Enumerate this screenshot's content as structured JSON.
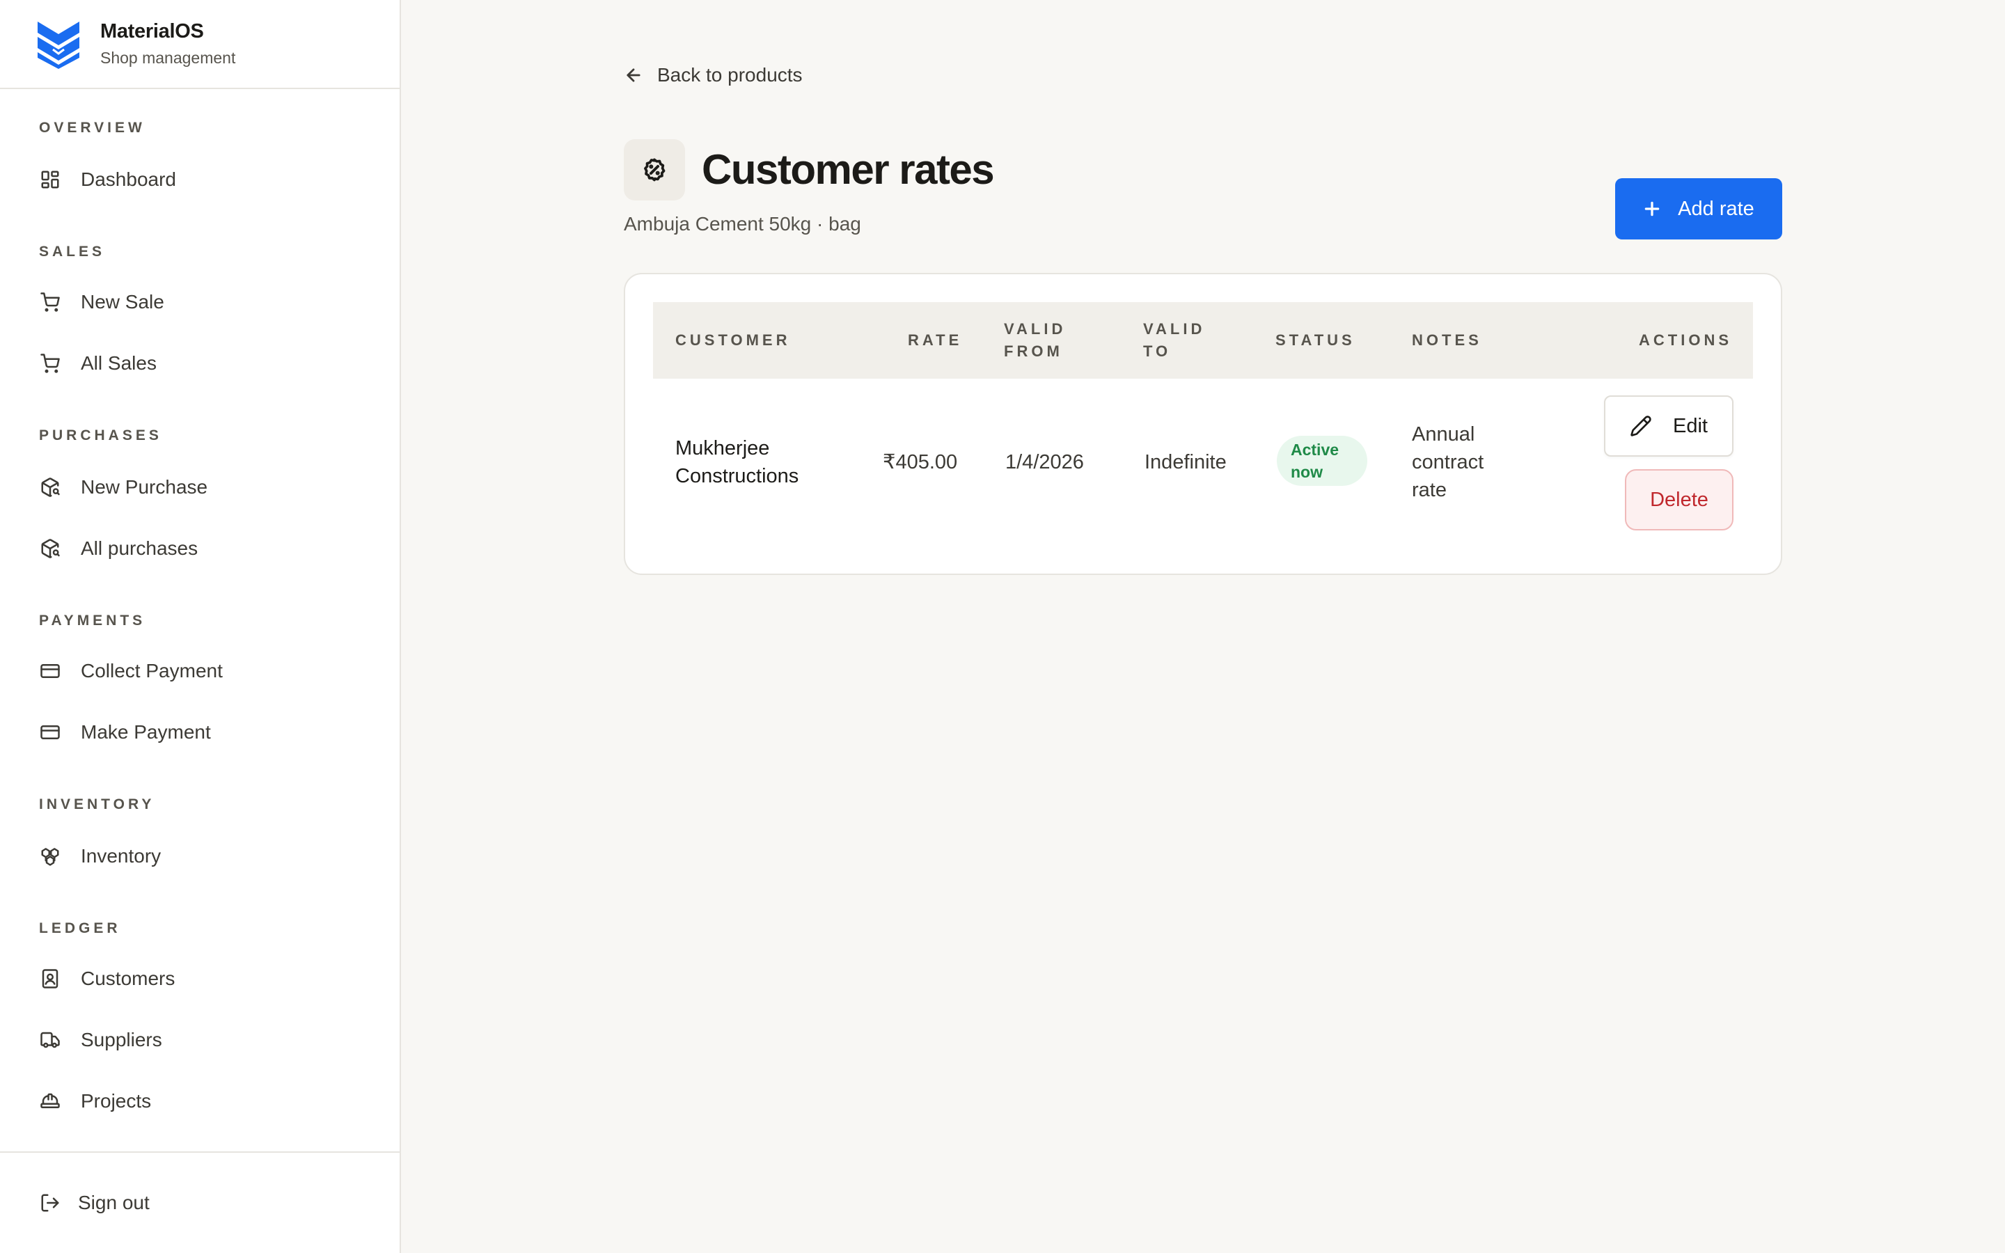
{
  "brand": {
    "name": "MaterialOS",
    "subtitle": "Shop management"
  },
  "sidebar": {
    "sections": [
      {
        "label": "OVERVIEW",
        "items": [
          {
            "label": "Dashboard",
            "icon": "grid-icon"
          }
        ]
      },
      {
        "label": "SALES",
        "items": [
          {
            "label": "New Sale",
            "icon": "cart-icon"
          },
          {
            "label": "All Sales",
            "icon": "cart-icon"
          }
        ]
      },
      {
        "label": "PURCHASES",
        "items": [
          {
            "label": "New Purchase",
            "icon": "package-search-icon"
          },
          {
            "label": "All purchases",
            "icon": "package-search-icon"
          }
        ]
      },
      {
        "label": "PAYMENTS",
        "items": [
          {
            "label": "Collect Payment",
            "icon": "credit-card-icon"
          },
          {
            "label": "Make Payment",
            "icon": "credit-card-icon"
          }
        ]
      },
      {
        "label": "INVENTORY",
        "items": [
          {
            "label": "Inventory",
            "icon": "boxes-icon"
          }
        ]
      },
      {
        "label": "LEDGER",
        "items": [
          {
            "label": "Customers",
            "icon": "contact-icon"
          },
          {
            "label": "Suppliers",
            "icon": "truck-icon"
          },
          {
            "label": "Projects",
            "icon": "hard-hat-icon"
          }
        ]
      }
    ],
    "signout": "Sign out"
  },
  "page": {
    "back_label": "Back to products",
    "title": "Customer rates",
    "subtitle": "Ambuja Cement 50kg · bag",
    "add_label": "Add rate"
  },
  "table": {
    "headers": {
      "customer": "CUSTOMER",
      "rate": "RATE",
      "valid_from_1": "VALID",
      "valid_from_2": "FROM",
      "valid_to_1": "VALID",
      "valid_to_2": "TO",
      "status": "STATUS",
      "notes": "NOTES",
      "actions": "ACTIONS"
    },
    "rows": [
      {
        "customer_1": "Mukherjee",
        "customer_2": "Constructions",
        "rate": "₹405.00",
        "valid_from": "1/4/2026",
        "valid_to": "Indefinite",
        "status_1": "Active",
        "status_2": "now",
        "notes_1": "Annual",
        "notes_2": "contract",
        "notes_3": "rate",
        "edit_label": "Edit",
        "delete_label": "Delete"
      }
    ]
  },
  "colors": {
    "accent": "#1a6cf0",
    "success": "#1f8a48",
    "danger": "#c0282d"
  }
}
